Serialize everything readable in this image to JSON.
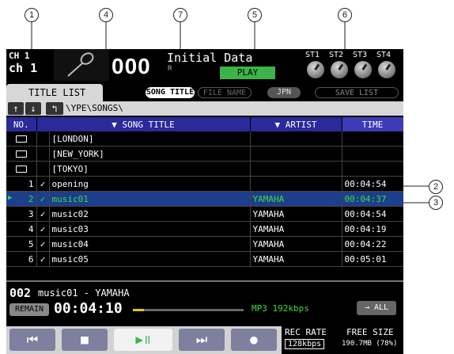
{
  "callouts": [
    "1",
    "4",
    "7",
    "5",
    "6",
    "2",
    "3"
  ],
  "header": {
    "ch_small": "CH 1",
    "ch_big": "ch 1",
    "mic_icon": "microphone-icon",
    "scene_number": "000",
    "scene_name": "Initial Data",
    "scene_sub": "R",
    "status": "PLAY",
    "stereo_labels": [
      "ST1",
      "ST2",
      "ST3",
      "ST4"
    ]
  },
  "tabs": {
    "title_list": "TITLE LIST",
    "song_title": "SONG TITLE",
    "file_name": "FILE NAME",
    "jpn": "JPN",
    "save_list": "SAVE LIST"
  },
  "nav": {
    "up_arrow": "↑",
    "down_arrow": "↓",
    "back_button": "↰",
    "path": "\\YPE\\SONGS\\"
  },
  "table": {
    "headers": {
      "no": "NO.",
      "title": "SONG TITLE",
      "artist": "ARTIST",
      "time": "TIME"
    },
    "rows": [
      {
        "no": "",
        "check": "",
        "title": "[LONDON]",
        "artist": "",
        "time": "",
        "folder": true
      },
      {
        "no": "",
        "check": "",
        "title": "[NEW_YORK]",
        "artist": "",
        "time": "",
        "folder": true
      },
      {
        "no": "",
        "check": "",
        "title": "[TOKYO]",
        "artist": "",
        "time": "",
        "folder": true
      },
      {
        "no": "1",
        "check": "✓",
        "title": "opening",
        "artist": "",
        "time": "00:04:54",
        "folder": false
      },
      {
        "no": "2",
        "check": "✓",
        "title": "music01",
        "artist": "YAMAHA",
        "time": "00:04:37",
        "folder": false,
        "selected": true
      },
      {
        "no": "3",
        "check": "✓",
        "title": "music02",
        "artist": "YAMAHA",
        "time": "00:04:54",
        "folder": false
      },
      {
        "no": "4",
        "check": "✓",
        "title": "music03",
        "artist": "YAMAHA",
        "time": "00:04:19",
        "folder": false
      },
      {
        "no": "5",
        "check": "✓",
        "title": "music04",
        "artist": "YAMAHA",
        "time": "00:04:22",
        "folder": false
      },
      {
        "no": "6",
        "check": "✓",
        "title": "music05",
        "artist": "YAMAHA",
        "time": "00:05:01",
        "folder": false
      }
    ]
  },
  "now_playing": {
    "number": "002",
    "title": "music01 - YAMAHA",
    "remain_label": "REMAIN",
    "remain_time": "00:04:10",
    "format": "MP3  192kbps",
    "all_button": "→ ALL",
    "progress_fraction": 0.1
  },
  "transport": {
    "rec_rate_label": "REC RATE",
    "rec_rate_value": "128kbps",
    "free_size_label": "FREE SIZE",
    "free_size_value": "190.7MB (78%)"
  },
  "colors": {
    "header_blue": "#2a2a9a",
    "play_green": "#3cb44a",
    "selected_row": "#1c3e8c",
    "selected_text": "#3cdc3c"
  }
}
